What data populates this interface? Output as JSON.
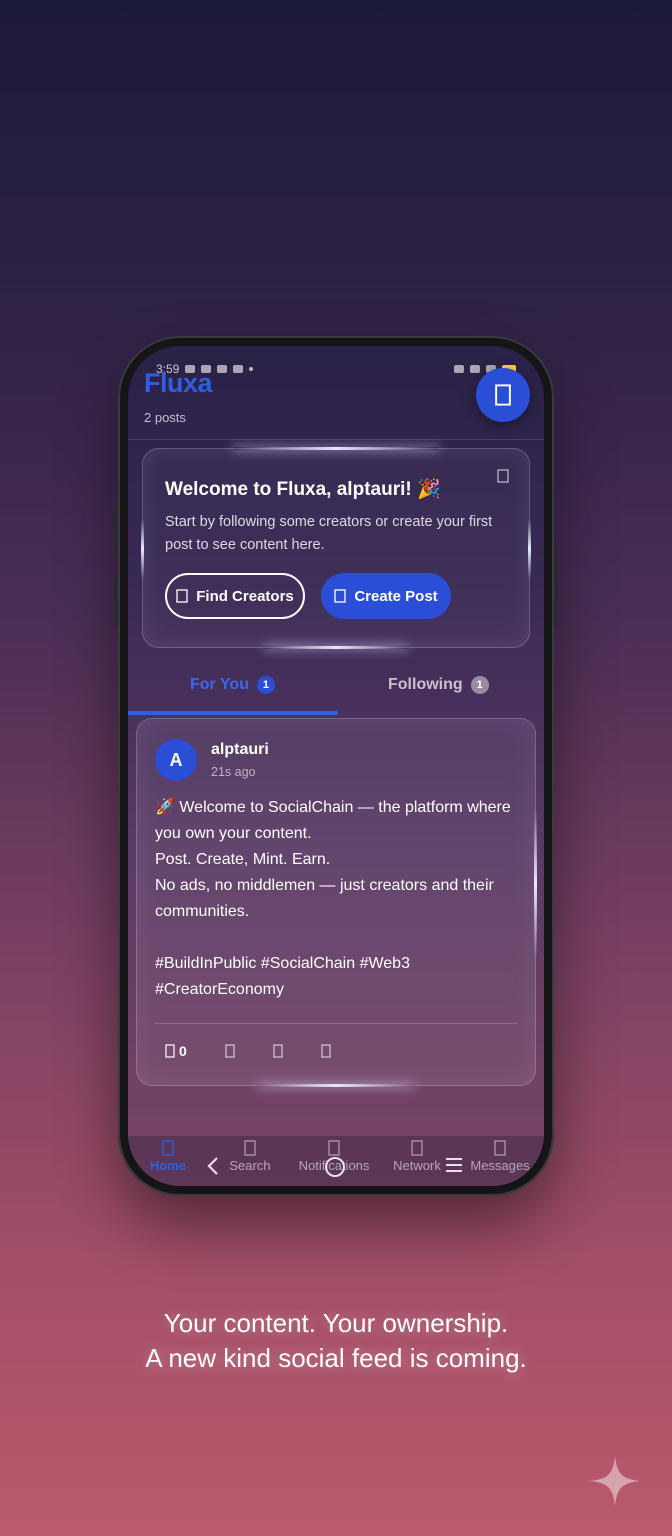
{
  "status": {
    "time": "3:59"
  },
  "header": {
    "brand": "Fluxa",
    "post_count": "2 posts"
  },
  "welcome": {
    "title": "Welcome to Fluxa, alptauri! 🎉",
    "text": "Start by following some creators or create your first post to see content here.",
    "find_label": "Find Creators",
    "create_label": "Create Post"
  },
  "tabs": [
    {
      "label": "For You",
      "count": "1"
    },
    {
      "label": "Following",
      "count": "1"
    }
  ],
  "post": {
    "avatar_letter": "A",
    "author": "alptauri",
    "time": "21s ago",
    "lines": [
      "🚀 Welcome to SocialChain — the platform where you own your content.",
      "Post. Create, Mint. Earn.",
      "No ads, no middlemen — just creators and their communities."
    ],
    "hashtags": "#BuildInPublic #SocialChain #Web3 #CreatorEconomy",
    "like_count": "0"
  },
  "nav": {
    "home": "Home",
    "search": "Search",
    "notifications": "Notifications",
    "network": "Network",
    "messages": "Messages"
  },
  "tagline": {
    "line1": "Your content. Your ownership.",
    "line2": "A new kind social feed is coming."
  },
  "colors": {
    "accent": "#2a4fd6",
    "tab_active": "#3b67ec",
    "battery": "#ffd33d"
  }
}
